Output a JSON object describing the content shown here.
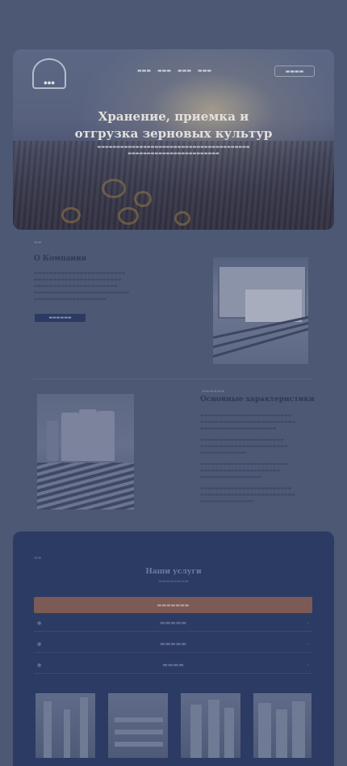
{
  "hero": {
    "title": "Хранение, приемка и отгрузка зерновых культур"
  },
  "about": {
    "title": "О Компании"
  },
  "specs": {
    "title": "Основные характеристики"
  },
  "services": {
    "title": "Наши услуги"
  },
  "colors": {
    "page_bg": "#4d5874",
    "panel_bg": "#2c3b63",
    "accent": "#7c5a55"
  }
}
